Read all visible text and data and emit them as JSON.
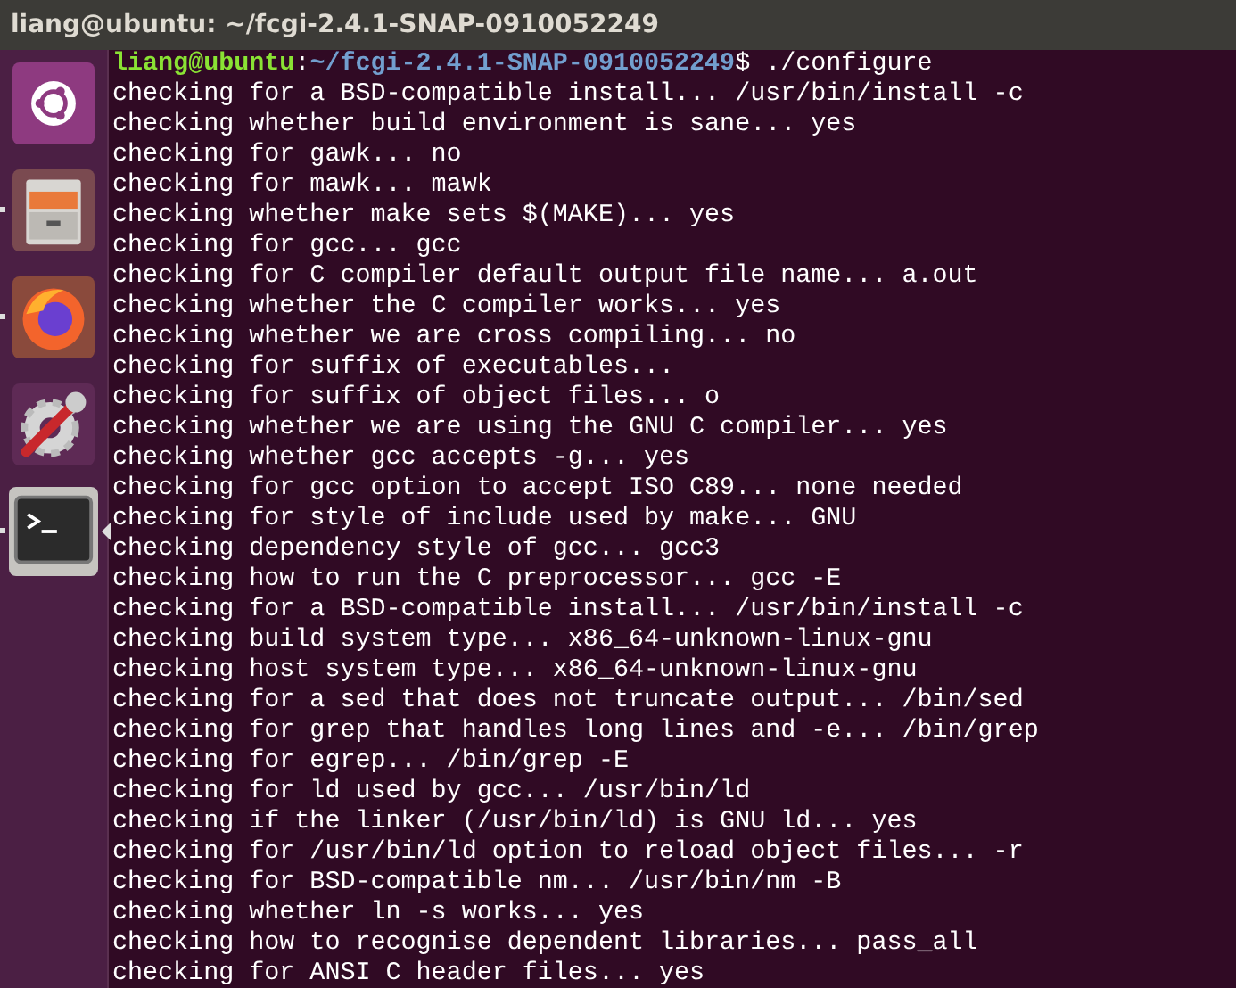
{
  "window": {
    "title": "liang@ubuntu: ~/fcgi-2.4.1-SNAP-0910052249"
  },
  "launcher": [
    {
      "kind": "ubuntu",
      "running": false,
      "selected": false
    },
    {
      "kind": "files",
      "running": true,
      "selected": false
    },
    {
      "kind": "browser",
      "running": true,
      "selected": false
    },
    {
      "kind": "settings",
      "running": false,
      "selected": false
    },
    {
      "kind": "terminal",
      "running": true,
      "selected": true
    }
  ],
  "prompt": {
    "user_host": "liang@ubuntu",
    "separator": ":",
    "path": "~/fcgi-2.4.1-SNAP-0910052249",
    "symbol": "$",
    "command": "./configure"
  },
  "output": [
    "checking for a BSD-compatible install... /usr/bin/install -c",
    "checking whether build environment is sane... yes",
    "checking for gawk... no",
    "checking for mawk... mawk",
    "checking whether make sets $(MAKE)... yes",
    "checking for gcc... gcc",
    "checking for C compiler default output file name... a.out",
    "checking whether the C compiler works... yes",
    "checking whether we are cross compiling... no",
    "checking for suffix of executables...",
    "checking for suffix of object files... o",
    "checking whether we are using the GNU C compiler... yes",
    "checking whether gcc accepts -g... yes",
    "checking for gcc option to accept ISO C89... none needed",
    "checking for style of include used by make... GNU",
    "checking dependency style of gcc... gcc3",
    "checking how to run the C preprocessor... gcc -E",
    "checking for a BSD-compatible install... /usr/bin/install -c",
    "checking build system type... x86_64-unknown-linux-gnu",
    "checking host system type... x86_64-unknown-linux-gnu",
    "checking for a sed that does not truncate output... /bin/sed",
    "checking for grep that handles long lines and -e... /bin/grep",
    "checking for egrep... /bin/grep -E",
    "checking for ld used by gcc... /usr/bin/ld",
    "checking if the linker (/usr/bin/ld) is GNU ld... yes",
    "checking for /usr/bin/ld option to reload object files... -r",
    "checking for BSD-compatible nm... /usr/bin/nm -B",
    "checking whether ln -s works... yes",
    "checking how to recognise dependent libraries... pass_all",
    "checking for ANSI C header files... yes"
  ]
}
